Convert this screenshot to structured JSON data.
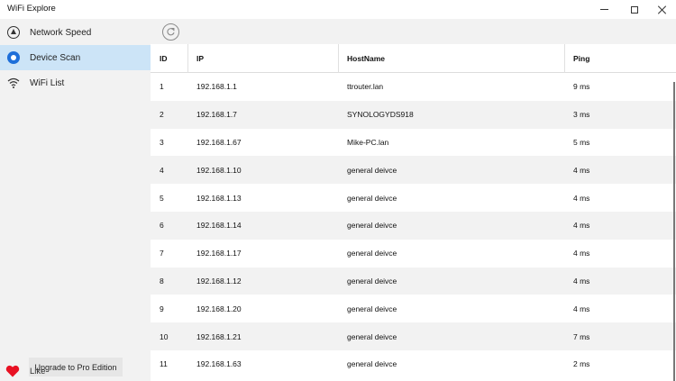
{
  "window": {
    "title": "WiFi Explore",
    "controls": {
      "minimize": "minimize",
      "maximize": "maximize",
      "close": "close"
    }
  },
  "sidebar": {
    "items": [
      {
        "label": "Network Speed",
        "icon": "speedometer-icon",
        "active": false
      },
      {
        "label": "Device Scan",
        "icon": "device-scan-icon",
        "active": true
      },
      {
        "label": "WiFi List",
        "icon": "wifi-icon",
        "active": false
      }
    ],
    "upgrade_label": "Upgrade to Pro Edition",
    "like_label": "Like"
  },
  "toolbar": {
    "refresh_icon": "refresh-icon"
  },
  "table": {
    "columns": [
      "ID",
      "IP",
      "HostName",
      "Ping"
    ],
    "rows": [
      {
        "id": "1",
        "ip": "192.168.1.1",
        "host": "ttrouter.lan",
        "ping": "9 ms"
      },
      {
        "id": "2",
        "ip": "192.168.1.7",
        "host": "SYNOLOGYDS918",
        "ping": "3 ms"
      },
      {
        "id": "3",
        "ip": "192.168.1.67",
        "host": "Mike-PC.lan",
        "ping": "5 ms"
      },
      {
        "id": "4",
        "ip": "192.168.1.10",
        "host": "general deivce",
        "ping": "4 ms"
      },
      {
        "id": "5",
        "ip": "192.168.1.13",
        "host": "general deivce",
        "ping": "4 ms"
      },
      {
        "id": "6",
        "ip": "192.168.1.14",
        "host": "general deivce",
        "ping": "4 ms"
      },
      {
        "id": "7",
        "ip": "192.168.1.17",
        "host": "general deivce",
        "ping": "4 ms"
      },
      {
        "id": "8",
        "ip": "192.168.1.12",
        "host": "general deivce",
        "ping": "4 ms"
      },
      {
        "id": "9",
        "ip": "192.168.1.20",
        "host": "general deivce",
        "ping": "4 ms"
      },
      {
        "id": "10",
        "ip": "192.168.1.21",
        "host": "general deivce",
        "ping": "7 ms"
      },
      {
        "id": "11",
        "ip": "192.168.1.63",
        "host": "general deivce",
        "ping": "2 ms"
      }
    ]
  },
  "colors": {
    "accent": "#1e6fd9",
    "active_nav": "#cce4f7",
    "heart": "#e81123",
    "stripe": "#f2f2f2"
  }
}
